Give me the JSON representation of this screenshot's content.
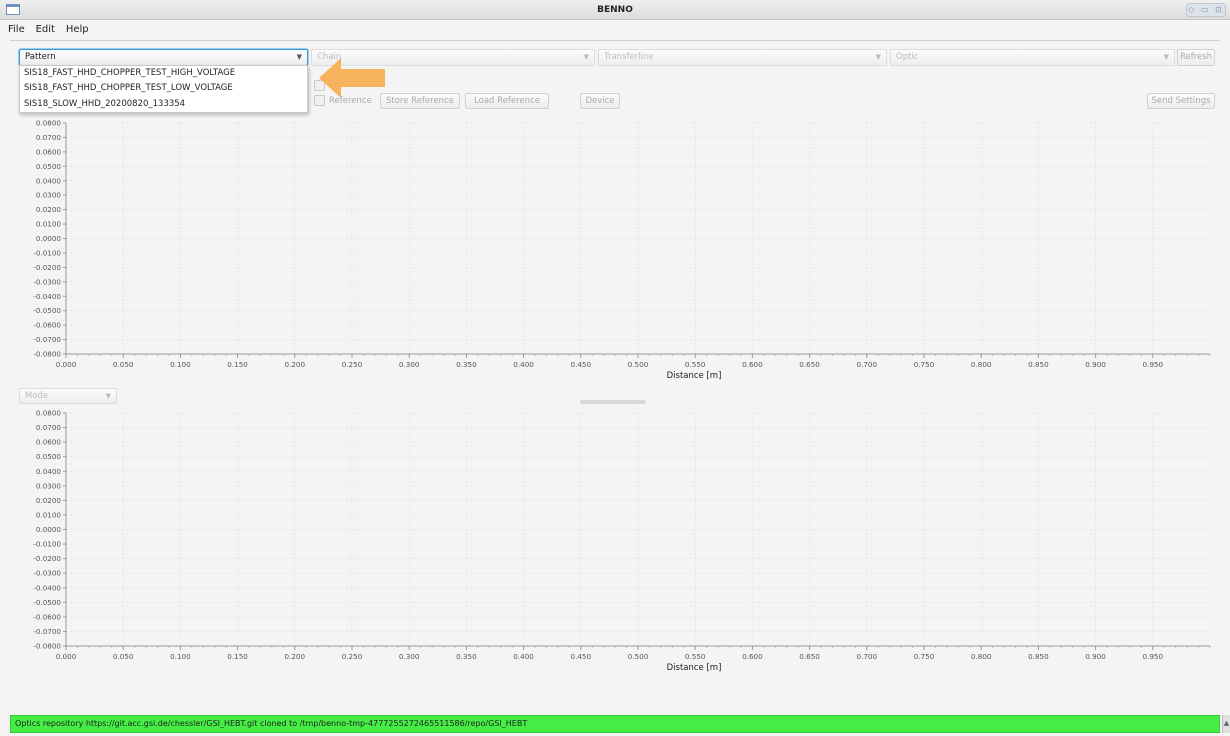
{
  "window": {
    "title": "BENNO"
  },
  "menu": [
    "File",
    "Edit",
    "Help"
  ],
  "toolbar": {
    "pattern": {
      "selected": "Pattern"
    },
    "chain": {
      "placeholder": "Chain"
    },
    "transferline": {
      "placeholder": "Transferline"
    },
    "optic": {
      "placeholder": "Optic"
    },
    "refresh_label": "Refresh",
    "reference_label": "Reference",
    "store_reference_label": "Store Reference",
    "load_reference_label": "Load Reference",
    "device_label": "Device",
    "send_settings_label": "Send Settings",
    "mode_placeholder": "Mode"
  },
  "pattern_options": [
    "SIS18_FAST_HHD_CHOPPER_TEST_HIGH_VOLTAGE",
    "SIS18_FAST_HHD_CHOPPER_TEST_LOW_VOLTAGE",
    "SIS18_SLOW_HHD_20200820_133354"
  ],
  "annotation": {
    "arrow_color": "#f7b35c"
  },
  "chart_data": [
    {
      "type": "line",
      "title": "",
      "xlabel": "Distance [m]",
      "ylabel": "",
      "xlim": [
        0.0,
        1.0
      ],
      "ylim": [
        -0.08,
        0.08
      ],
      "x_ticks": [
        "0.000",
        "0.050",
        "0.100",
        "0.150",
        "0.200",
        "0.250",
        "0.300",
        "0.350",
        "0.400",
        "0.450",
        "0.500",
        "0.550",
        "0.600",
        "0.650",
        "0.700",
        "0.750",
        "0.800",
        "0.850",
        "0.900",
        "0.950"
      ],
      "y_ticks": [
        "0.0800",
        "0.0700",
        "0.0600",
        "0.0500",
        "0.0400",
        "0.0300",
        "0.0200",
        "0.0100",
        "0.0000",
        "-0.0100",
        "-0.0200",
        "-0.0300",
        "-0.0400",
        "-0.0500",
        "-0.0600",
        "-0.0700",
        "-0.0800"
      ],
      "grid": true,
      "series": []
    },
    {
      "type": "line",
      "title": "",
      "xlabel": "Distance [m]",
      "ylabel": "",
      "xlim": [
        0.0,
        1.0
      ],
      "ylim": [
        -0.08,
        0.08
      ],
      "x_ticks": [
        "0.000",
        "0.050",
        "0.100",
        "0.150",
        "0.200",
        "0.250",
        "0.300",
        "0.350",
        "0.400",
        "0.450",
        "0.500",
        "0.550",
        "0.600",
        "0.650",
        "0.700",
        "0.750",
        "0.800",
        "0.850",
        "0.900",
        "0.950"
      ],
      "y_ticks": [
        "0.0800",
        "0.0700",
        "0.0600",
        "0.0500",
        "0.0400",
        "0.0300",
        "0.0200",
        "0.0100",
        "0.0000",
        "-0.0100",
        "-0.0200",
        "-0.0300",
        "-0.0400",
        "-0.0500",
        "-0.0600",
        "-0.0700",
        "-0.0800"
      ],
      "grid": true,
      "series": []
    }
  ],
  "status": {
    "message": "Optics repository https://git.acc.gsi.de/chessler/GSI_HEBT.git cloned to /tmp/benno-tmp-4777255272465511586/repo/GSI_HEBT",
    "color": "#44ee44"
  }
}
